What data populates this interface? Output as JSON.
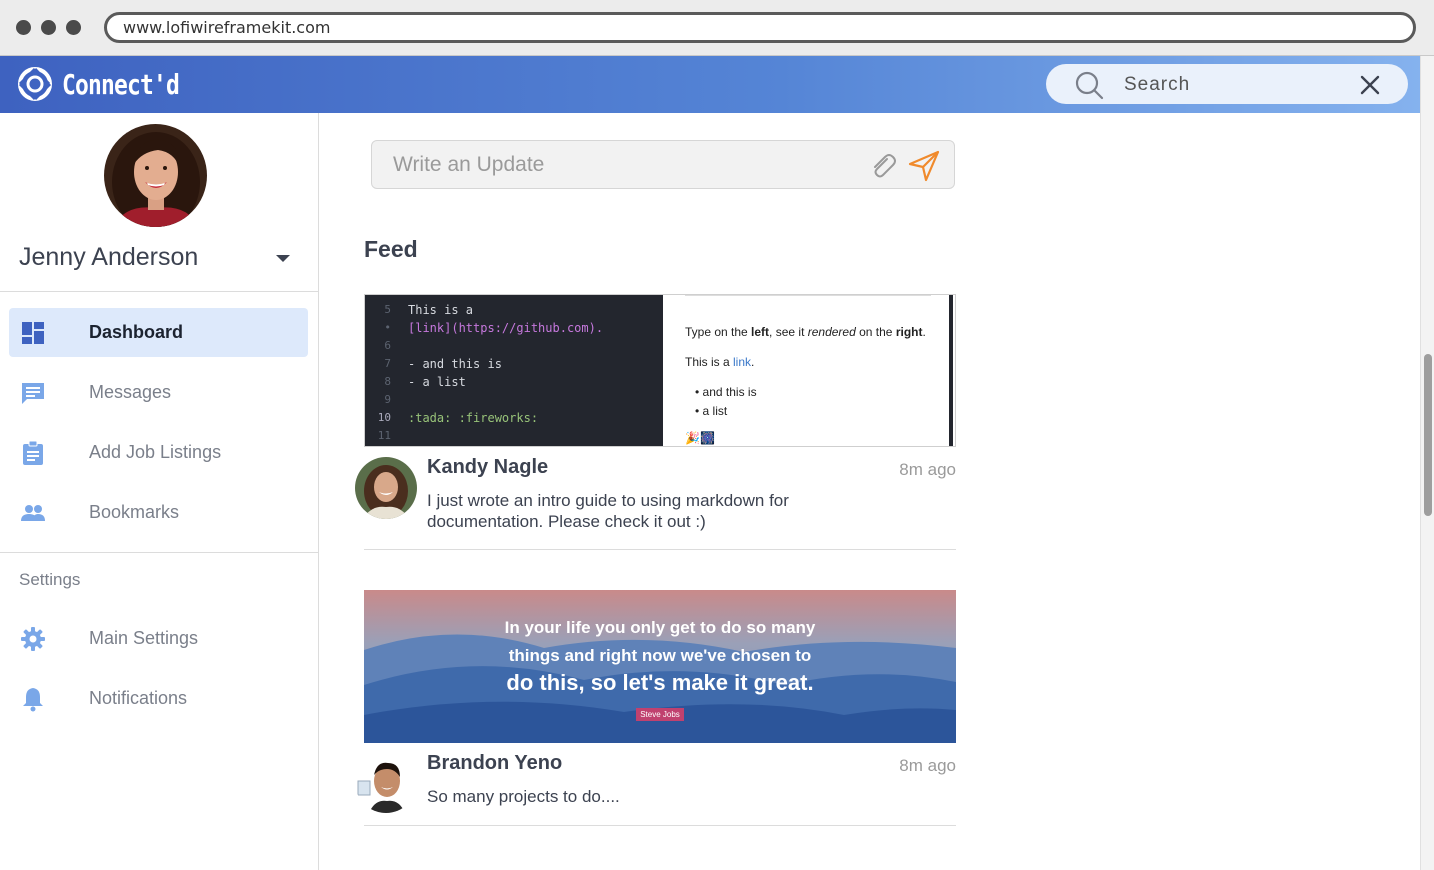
{
  "browser": {
    "url": "www.lofiwireframekit.com"
  },
  "app": {
    "brand": "Connect'd",
    "search_placeholder": "Search"
  },
  "colors": {
    "accent": "#3e62c0",
    "accent_light": "#85b2ee",
    "nav_icon": "#7aa7e8",
    "active_bg": "#dde9fb",
    "send": "#f08a2c"
  },
  "profile": {
    "name": "Jenny Anderson"
  },
  "nav": {
    "items": [
      {
        "label": "Dashboard",
        "icon": "dashboard-icon",
        "active": true
      },
      {
        "label": "Messages",
        "icon": "messages-icon",
        "active": false
      },
      {
        "label": "Add Job Listings",
        "icon": "clipboard-icon",
        "active": false
      },
      {
        "label": "Bookmarks",
        "icon": "people-icon",
        "active": false
      }
    ],
    "settings_header": "Settings",
    "settings_items": [
      {
        "label": "Main Settings",
        "icon": "gear-icon"
      },
      {
        "label": "Notifications",
        "icon": "bell-icon"
      }
    ]
  },
  "composer": {
    "placeholder": "Write an Update"
  },
  "feed": {
    "title": "Feed",
    "posts": [
      {
        "author": "Kandy Nagle",
        "time": "8m ago",
        "text": "I just wrote an intro guide to using markdown for documentation. Please check it out :)",
        "image": {
          "editor_lines": [
            {
              "num": "5",
              "code": "This is a"
            },
            {
              "num": "•",
              "code": "[link](https://github.com)."
            },
            {
              "num": "6",
              "code": ""
            },
            {
              "num": "7",
              "code": "- and this is"
            },
            {
              "num": "8",
              "code": "- a list"
            },
            {
              "num": "9",
              "code": ""
            },
            {
              "num": "10",
              "code": ":tada: :fireworks:"
            },
            {
              "num": "11",
              "code": ""
            }
          ],
          "preview": {
            "line1_a": "Type on the ",
            "line1_b": "left",
            "line1_c": ", see it ",
            "line1_d": "rendered",
            "line1_e": " on the ",
            "line1_f": "right",
            "line1_g": ".",
            "line2_a": "This is a ",
            "line2_b": "link",
            "line2_c": ".",
            "bullet1": "and this is",
            "bullet2": "a list"
          }
        }
      },
      {
        "author": "Brandon Yeno",
        "time": "8m ago",
        "text": "So many projects to do....",
        "image": {
          "quote_line1": "In your life you only get to do so many",
          "quote_line2": "things and right now we've chosen to",
          "quote_line3": "do this, so let's make it great.",
          "attribution": "Steve Jobs"
        }
      }
    ]
  }
}
